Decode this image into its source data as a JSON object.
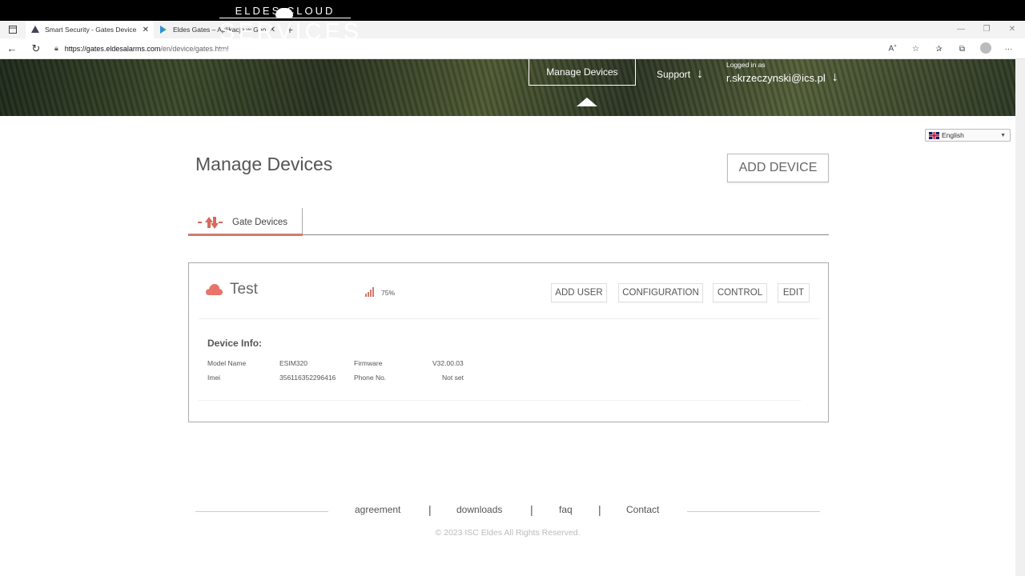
{
  "browser": {
    "tabs": [
      {
        "title": "Smart Security - Gates Device",
        "active": true
      },
      {
        "title": "Eldes Gates – Aplikacje w Google Play",
        "active": false
      }
    ],
    "new_tab_glyph": "+",
    "url_host": "https://gates.eldesalarms.com",
    "url_path": "/en/device/gates.html"
  },
  "header": {
    "logo_top": "ELDES   CLOUD",
    "logo_main": "SERVICES",
    "nav_manage": "Manage Devices",
    "nav_support": "Support",
    "logged_in_label": "Logged in as",
    "user_email": "r.skrzeczynski@ics.pl"
  },
  "language": {
    "selected": "English"
  },
  "page": {
    "title": "Manage Devices",
    "add_device_label": "ADD DEVICE",
    "tab_label": "Gate Devices"
  },
  "device": {
    "name": "Test",
    "signal": "75%",
    "buttons": {
      "add_user": "ADD USER",
      "configuration": "CONFIGURATION",
      "control": "CONTROL",
      "edit": "EDIT"
    },
    "info_title": "Device Info:",
    "info": {
      "model_label": "Model Name",
      "model_value": "ESIM320",
      "firmware_label": "Firmware",
      "firmware_value": "V32.00.03",
      "imei_label": "Imei",
      "imei_value": "356116352296416",
      "phone_label": "Phone No.",
      "phone_value": "Not set"
    }
  },
  "footer": {
    "links": [
      "agreement",
      "downloads",
      "faq",
      "Contact"
    ],
    "separator": "|",
    "copyright": "© 2023 ISC Eldes All Rights Reserved."
  },
  "colors": {
    "accent": "#d17a6e"
  }
}
